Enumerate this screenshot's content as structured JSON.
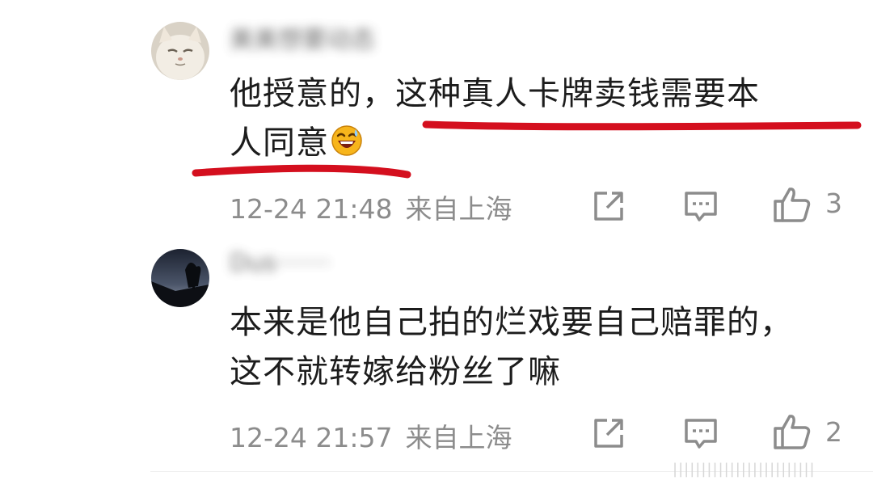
{
  "comments": [
    {
      "username": "美美想要动态",
      "text_line1": "他授意的，这种真人卡牌卖钱需要本",
      "text_line2": "人同意",
      "emoji": "grinning-sweat-emoji",
      "date": "12-24 21:48",
      "location": "来自上海",
      "like_count": "3"
    },
    {
      "username": "Dus·······",
      "text_line1": "本来是他自己拍的烂戏要自己赔罪的，",
      "text_line2": "这不就转嫁给粉丝了嘛",
      "date": "12-24 21:57",
      "location": "来自上海",
      "like_count": "2"
    }
  ],
  "icons": {
    "share": "share-icon",
    "comment": "comment-icon",
    "like": "thumbs-up-icon"
  },
  "colors": {
    "underline": "#d40f1e",
    "meta_text": "#8c8c8c",
    "body_text": "#1c1c1c"
  },
  "watermark": "|||||||||||||||||||||||||"
}
